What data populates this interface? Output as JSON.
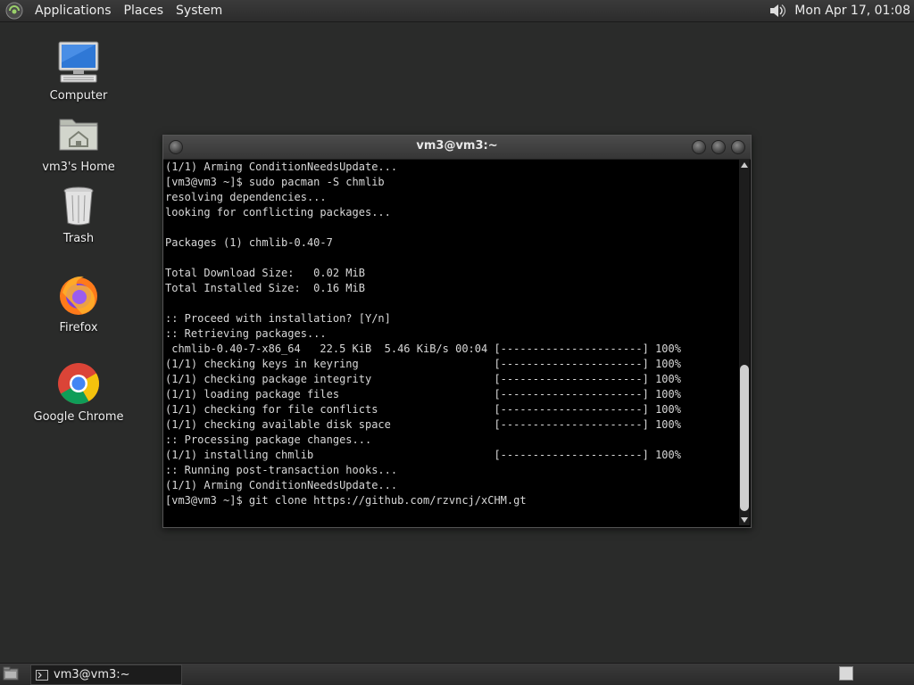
{
  "top_panel": {
    "menus": [
      "Applications",
      "Places",
      "System"
    ],
    "clock": "Mon Apr 17, 01:08",
    "icons": [
      "distro-logo-icon",
      "volume-icon"
    ]
  },
  "desktop": {
    "icons": [
      {
        "label": "Computer",
        "icon": "computer-icon"
      },
      {
        "label": "vm3's Home",
        "icon": "home-folder-icon"
      },
      {
        "label": "Trash",
        "icon": "trash-icon"
      },
      {
        "label": "Firefox",
        "icon": "firefox-icon"
      },
      {
        "label": "Google Chrome",
        "icon": "chrome-icon"
      }
    ]
  },
  "terminal": {
    "title": "vm3@vm3:~",
    "lines": [
      "(1/1) Arming ConditionNeedsUpdate...",
      "[vm3@vm3 ~]$ sudo pacman -S chmlib",
      "resolving dependencies...",
      "looking for conflicting packages...",
      "",
      "Packages (1) chmlib-0.40-7",
      "",
      "Total Download Size:   0.02 MiB",
      "Total Installed Size:  0.16 MiB",
      "",
      ":: Proceed with installation? [Y/n]",
      ":: Retrieving packages...",
      " chmlib-0.40-7-x86_64   22.5 KiB  5.46 KiB/s 00:04 [----------------------] 100%",
      "(1/1) checking keys in keyring                     [----------------------] 100%",
      "(1/1) checking package integrity                   [----------------------] 100%",
      "(1/1) loading package files                        [----------------------] 100%",
      "(1/1) checking for file conflicts                  [----------------------] 100%",
      "(1/1) checking available disk space                [----------------------] 100%",
      ":: Processing package changes...",
      "(1/1) installing chmlib                            [----------------------] 100%",
      ":: Running post-transaction hooks...",
      "(1/1) Arming ConditionNeedsUpdate...",
      "[vm3@vm3 ~]$ git clone https://github.com/rzvncj/xCHM.gt"
    ]
  },
  "bottom_panel": {
    "task_label": "vm3@vm3:~"
  },
  "colors": {
    "desktop_bg": "#2a2b2a",
    "terminal_bg": "#000000",
    "terminal_fg": "#d8d8d8"
  }
}
